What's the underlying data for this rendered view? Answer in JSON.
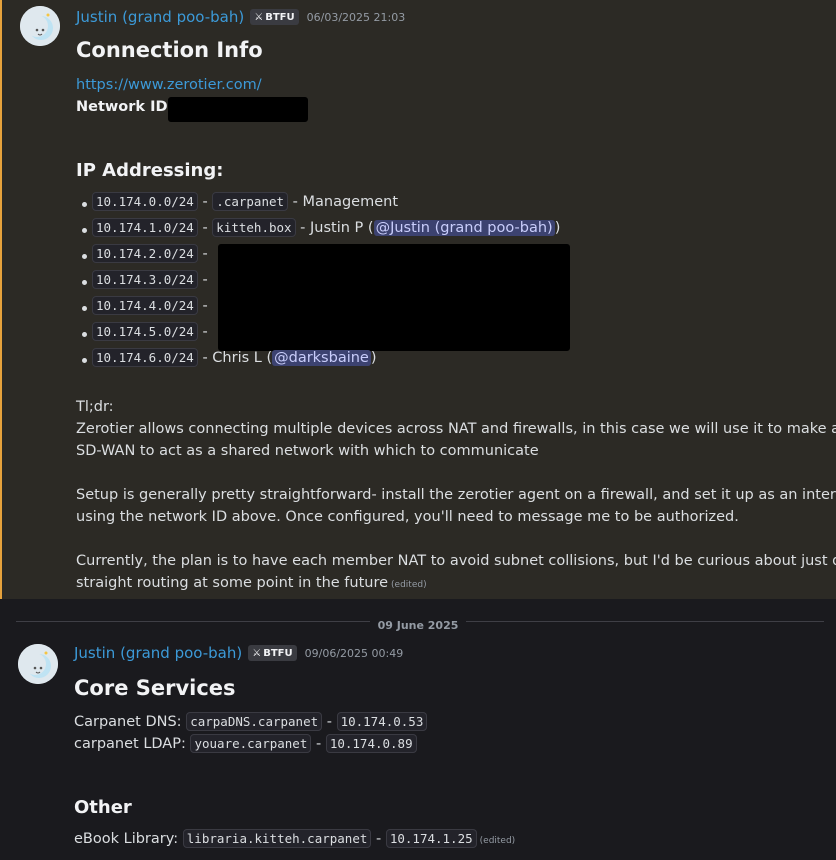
{
  "message1": {
    "username": "Justin (grand poo-bah)",
    "badge": "BTFU",
    "timestamp": "06/03/2025 21:03",
    "title": "Connection Info",
    "url": "https://www.zerotier.com/",
    "network_id_label": "Network ID:",
    "ip_heading": "IP Addressing:",
    "ip_items": [
      {
        "subnet": "10.174.0.0/24",
        "sep": " - ",
        "host": ".carpanet",
        "tail": " - Management"
      },
      {
        "subnet": "10.174.1.0/24",
        "sep": " - ",
        "host": "kitteh.box",
        "tail": " - Justin P (",
        "mention": "@Justin (grand poo-bah)",
        "close": ")"
      },
      {
        "subnet": "10.174.2.0/24",
        "sep": " -"
      },
      {
        "subnet": "10.174.3.0/24",
        "sep": " -"
      },
      {
        "subnet": "10.174.4.0/24",
        "sep": " -"
      },
      {
        "subnet": "10.174.5.0/24",
        "sep": " -"
      },
      {
        "subnet": "10.174.6.0/24",
        "sep": " - Chris L (",
        "mention": "@darksbaine",
        "close": ")"
      }
    ],
    "tldr": "Tl;dr:",
    "para1_l1": "Zerotier allows connecting multiple devices across NAT and firewalls, in this case we will use it to make an",
    "para1_l2": "SD-WAN to act as a shared network with which to communicate",
    "para2_l1": "Setup is generally pretty straightforward- install the zerotier agent on a firewall, and set it up as an interface",
    "para2_l2": "using the network ID above. Once configured, you'll need to message me to be authorized.",
    "para3_l1": "Currently, the plan is to have each member NAT to avoid subnet collisions, but I'd be curious about just doing",
    "para3_l2": "straight routing at some point in the future",
    "edited": "(edited)"
  },
  "divider": {
    "date": "09 June 2025"
  },
  "message2": {
    "username": "Justin (grand poo-bah)",
    "badge": "BTFU",
    "timestamp": "09/06/2025 00:49",
    "title": "Core Services",
    "dns_label": "Carpanet DNS: ",
    "dns_host": "carpaDNS.carpanet",
    "dns_sep": " - ",
    "dns_ip": "10.174.0.53",
    "ldap_label": "carpanet LDAP: ",
    "ldap_host": "youare.carpanet",
    "ldap_sep": " - ",
    "ldap_ip": "10.174.0.89",
    "other_heading": "Other",
    "ebook_label": "eBook Library: ",
    "ebook_host": "libraria.kitteh.carpanet",
    "ebook_sep": " - ",
    "ebook_ip": "10.174.1.25",
    "edited": "(edited)"
  },
  "colors": {
    "accent_bar": "#e6a23c",
    "username": "#3c9ad8",
    "mention_bg": "#3c4270"
  },
  "icons": {
    "avatar": "moon-avatar-icon",
    "badge": "sword-icon"
  }
}
